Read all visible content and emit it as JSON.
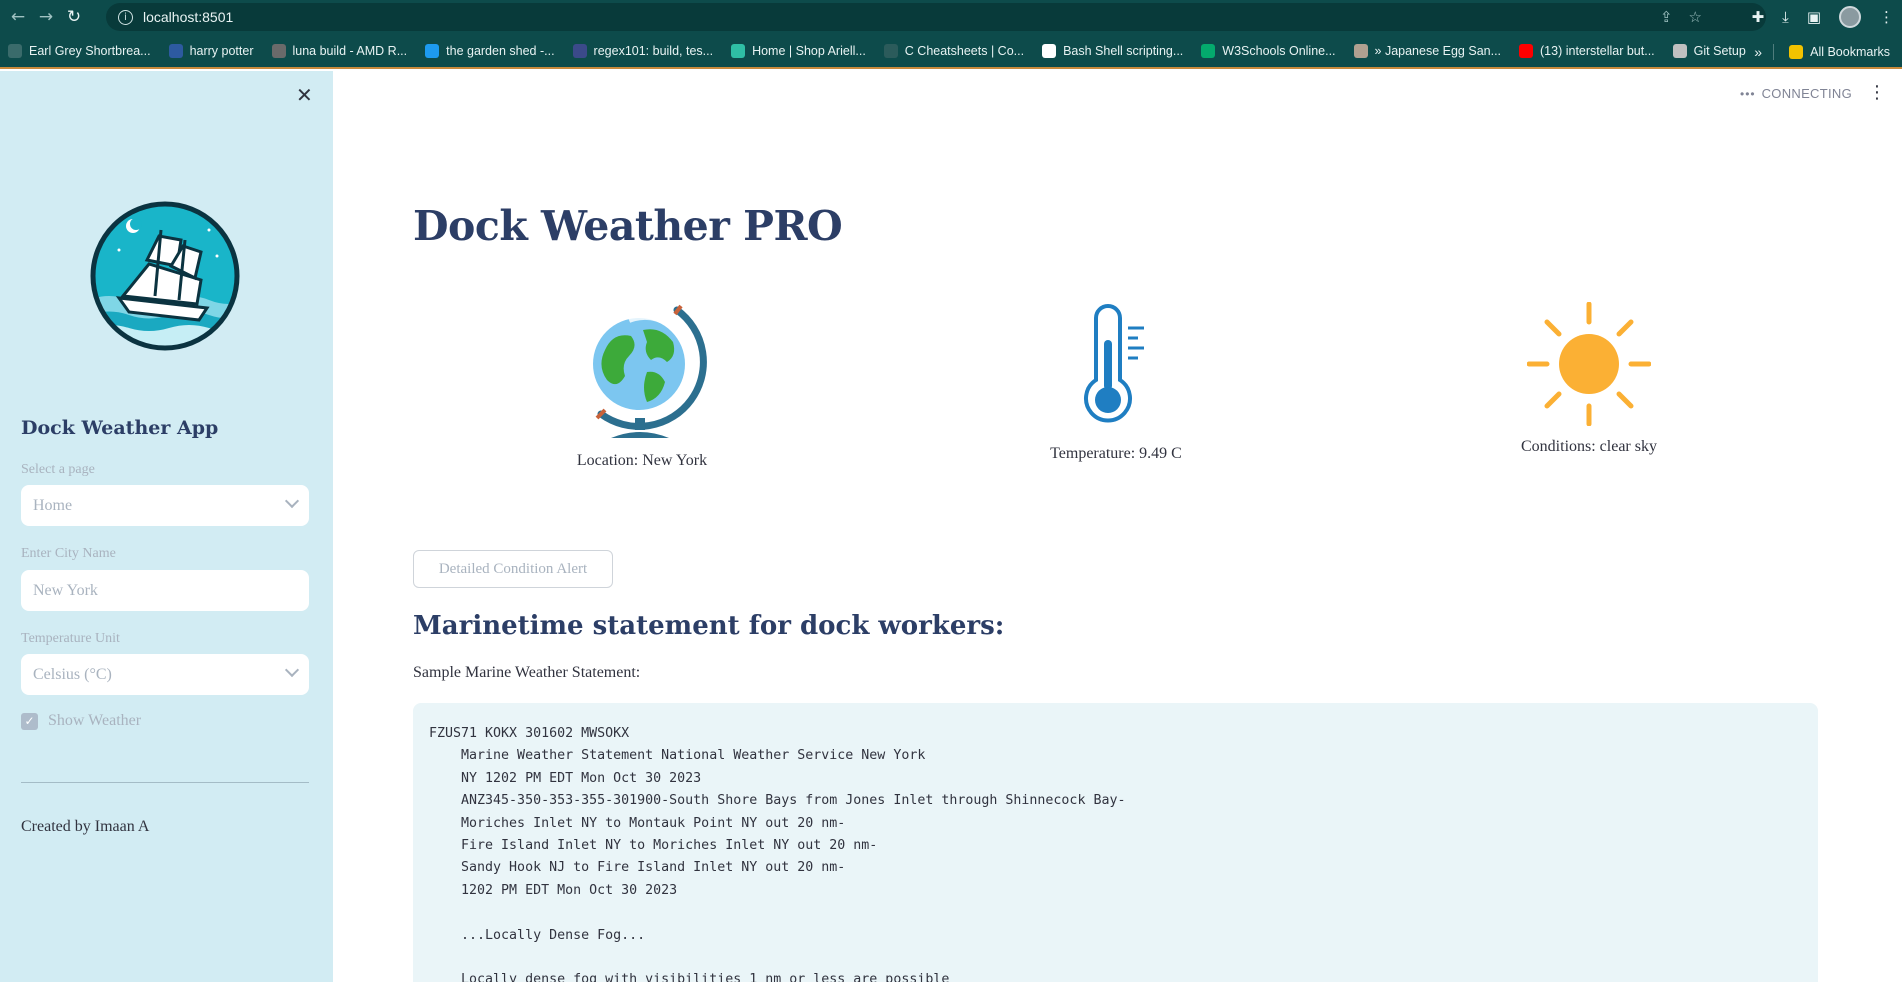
{
  "browser": {
    "url": "localhost:8501",
    "nav": {
      "back_icon": "←",
      "forward_icon": "→",
      "reload_icon": "↻"
    },
    "bookmarks": [
      {
        "label": "Earl Grey Shortbrea...",
        "color": "#3a6b6b"
      },
      {
        "label": "harry potter",
        "color": "#2d5aa0"
      },
      {
        "label": "luna build - AMD R...",
        "color": "#6a6a6a"
      },
      {
        "label": "the garden shed -...",
        "color": "#1d9bf0"
      },
      {
        "label": "regex101: build, tes...",
        "color": "#3b4a8a"
      },
      {
        "label": "Home | Shop Ariell...",
        "color": "#2fbfa5"
      },
      {
        "label": "C Cheatsheets | Co...",
        "color": "#2b5b5b"
      },
      {
        "label": "Bash Shell scripting...",
        "color": "#ffffff"
      },
      {
        "label": "W3Schools Online...",
        "color": "#04aa6d"
      },
      {
        "label": "» Japanese Egg San...",
        "color": "#b0a090"
      },
      {
        "label": "(13) interstellar but...",
        "color": "#ff0000"
      },
      {
        "label": "Git Setup",
        "color": "#c0c0c0"
      }
    ],
    "more_label": "»",
    "all_bookmarks": "All Bookmarks"
  },
  "sidebar": {
    "close_icon": "✕",
    "app_title": "Dock Weather App",
    "page_select": {
      "label": "Select a page",
      "value": "Home"
    },
    "city_input": {
      "label": "Enter City Name",
      "placeholder": "New York"
    },
    "unit_select": {
      "label": "Temperature Unit",
      "value": "Celsius (°C)"
    },
    "show_weather": {
      "label": "Show Weather",
      "checked": true
    },
    "created_by": "Created by Imaan A"
  },
  "status": {
    "text": "CONNECTING",
    "menu_icon": "⋮"
  },
  "main": {
    "title": "Dock Weather PRO",
    "metrics": {
      "location": "Location: New York",
      "temperature": "Temperature: 9.49 C",
      "conditions": "Conditions: clear sky"
    },
    "alert_button": "Detailed Condition Alert",
    "section_title": "Marinetime statement for dock workers:",
    "sample_label": "Sample Marine Weather Statement:",
    "statement": "FZUS71 KOKX 301602 MWSOKX\n    Marine Weather Statement National Weather Service New York\n    NY 1202 PM EDT Mon Oct 30 2023\n    ANZ345-350-353-355-301900-South Shore Bays from Jones Inlet through Shinnecock Bay-\n    Moriches Inlet NY to Montauk Point NY out 20 nm-\n    Fire Island Inlet NY to Moriches Inlet NY out 20 nm-\n    Sandy Hook NJ to Fire Island Inlet NY out 20 nm-\n    1202 PM EDT Mon Oct 30 2023\n\n    ...Locally Dense Fog...\n\n    Locally dense fog with visibilities 1 nm or less are possible"
  }
}
